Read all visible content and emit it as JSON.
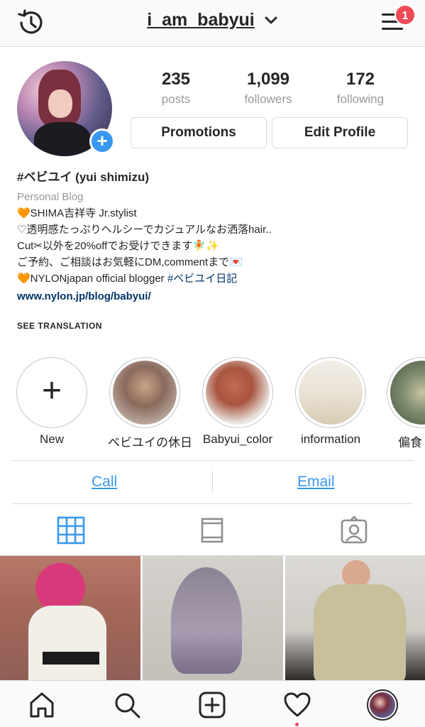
{
  "header": {
    "username": "i_am_babyui",
    "notification_count": "1"
  },
  "stats": [
    {
      "value": "235",
      "label": "posts"
    },
    {
      "value": "1,099",
      "label": "followers"
    },
    {
      "value": "172",
      "label": "following"
    }
  ],
  "buttons": {
    "promotions": "Promotions",
    "edit_profile": "Edit Profile"
  },
  "bio": {
    "name": "#ベビユイ (yui shimizu)",
    "category": "Personal Blog",
    "lines": [
      "🧡SHIMA吉祥寺 Jr.stylist",
      "♡透明感たっぷりヘルシーでカジュアルなお洒落hair..",
      "Cut✂︎以外を20%offでお受けできます🧚✨",
      "ご予約、ご相談はお気軽にDM,commentまで💌"
    ],
    "line5_prefix": "🧡NYLONjapan official blogger ",
    "line5_tag": "#ベビユイ日記",
    "link": "www.nylon.jp/blog/babyui/",
    "see_translation": "SEE TRANSLATION"
  },
  "highlights": [
    {
      "label": "New"
    },
    {
      "label": "ベビユイの休日"
    },
    {
      "label": "Babyui_color"
    },
    {
      "label": "information"
    },
    {
      "label": "偏食"
    }
  ],
  "contact": {
    "call": "Call",
    "email": "Email"
  },
  "colors": {
    "accent": "#3897f0",
    "badge": "#ed4956",
    "link": "#003569"
  }
}
